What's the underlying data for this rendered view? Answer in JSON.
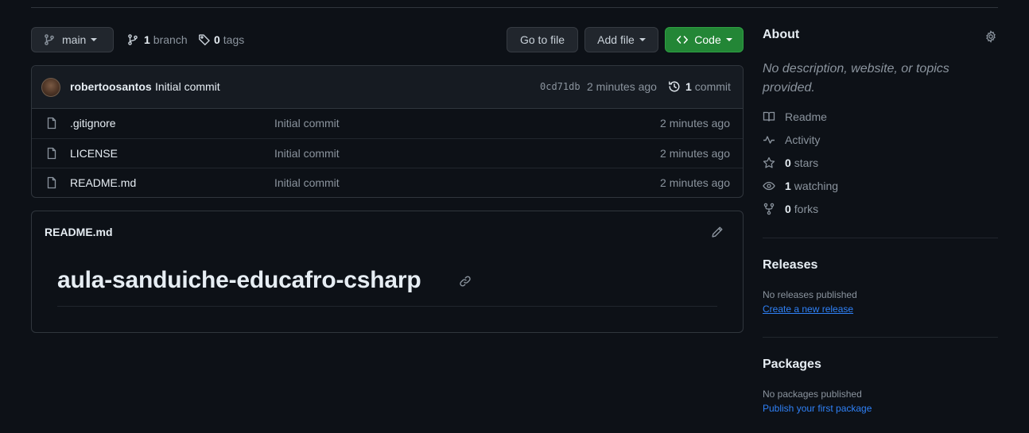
{
  "toolbar": {
    "branch": "main",
    "branch_count": "1",
    "branch_label": "branch",
    "tag_count": "0",
    "tag_label": "tags",
    "goto_file": "Go to file",
    "add_file": "Add file",
    "code": "Code"
  },
  "latest_commit": {
    "author": "robertoosantos",
    "message": "Initial commit",
    "sha": "0cd71db",
    "time": "2 minutes ago",
    "count": "1",
    "count_label": "commit"
  },
  "files": [
    {
      "name": ".gitignore",
      "message": "Initial commit",
      "time": "2 minutes ago"
    },
    {
      "name": "LICENSE",
      "message": "Initial commit",
      "time": "2 minutes ago"
    },
    {
      "name": "README.md",
      "message": "Initial commit",
      "time": "2 minutes ago"
    }
  ],
  "readme": {
    "filename": "README.md",
    "heading": "aula-sanduiche-educafro-csharp"
  },
  "about": {
    "title": "About",
    "description": "No description, website, or topics provided.",
    "readme": "Readme",
    "activity": "Activity",
    "stars_count": "0",
    "stars_label": "stars",
    "watching_count": "1",
    "watching_label": "watching",
    "forks_count": "0",
    "forks_label": "forks"
  },
  "releases": {
    "title": "Releases",
    "empty": "No releases published",
    "create_link": "Create a new release"
  },
  "packages": {
    "title": "Packages",
    "empty": "No packages published",
    "publish_link": "Publish your first package"
  },
  "colors": {
    "background": "#0d1117",
    "border": "#30363d",
    "accent_green": "#238636",
    "link_blue": "#2f81f7",
    "muted": "#8b949e"
  }
}
